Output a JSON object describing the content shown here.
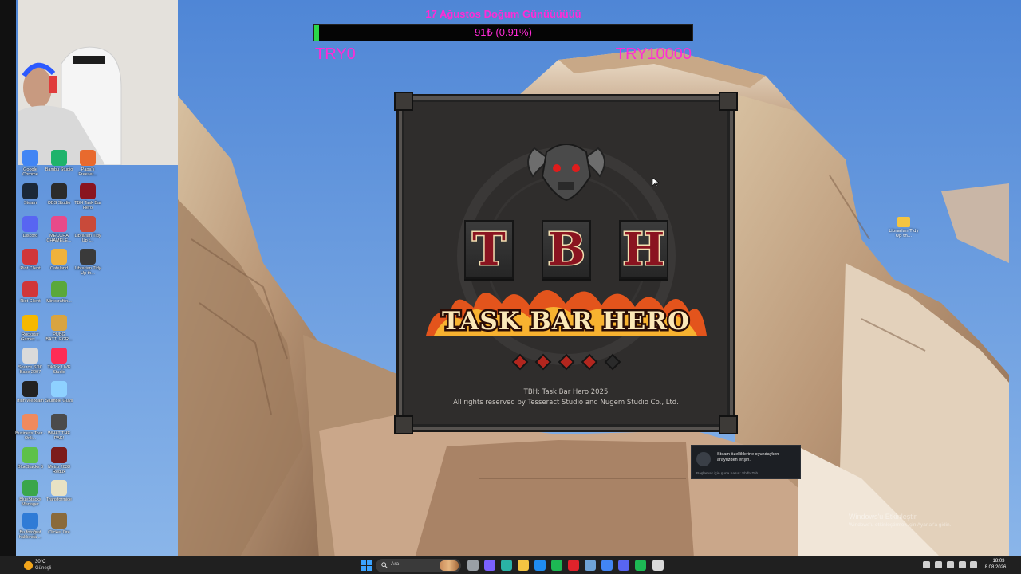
{
  "goal": {
    "title": "17 Ağustos Doğum Günüüüüüü",
    "progress_text": "91₺ (0.91%)",
    "progress_fraction": 0.0091,
    "min_label": "TRY0",
    "max_label": "TRY10000",
    "accent_color": "#ff2bd6",
    "fill_color": "#2bd84a"
  },
  "desktop_icons": [
    {
      "label": "Google Chrome",
      "icon": "chrome-icon"
    },
    {
      "label": "Bambu Studio",
      "icon": "bambu-icon"
    },
    {
      "label": "Papa's Freezer...",
      "icon": "papa-icon"
    },
    {
      "label": "Steam",
      "icon": "steam-icon"
    },
    {
      "label": "OBS Studio",
      "icon": "obs-icon"
    },
    {
      "label": "TBH Task Bar Hero",
      "icon": "tbh-icon"
    },
    {
      "label": "Discord",
      "icon": "discord-icon"
    },
    {
      "label": "MECCHA CHAMELE...",
      "icon": "meccha-icon"
    },
    {
      "label": "Librarian Tidy Up t...",
      "icon": "librarian-icon"
    },
    {
      "label": "Riot Client",
      "icon": "riot-icon"
    },
    {
      "label": "Cafeland",
      "icon": "cafeland-icon"
    },
    {
      "label": "Librarian Tidy Up th...",
      "icon": "librarian2-icon"
    },
    {
      "label": "Riot Client",
      "icon": "riot2-icon"
    },
    {
      "label": "Minecraftin...",
      "icon": "minecraft-icon"
    },
    {
      "label": "Rockstar Games ...",
      "icon": "rockstar-icon"
    },
    {
      "label": "PUBG BATTLEGR...",
      "icon": "pubg-icon"
    },
    {
      "label": "Source SDK Base 2007",
      "icon": "sourcesdk-icon"
    },
    {
      "label": "TikTok LIVE Studio",
      "icon": "tiktok-icon"
    },
    {
      "label": "Iriun Webcam",
      "icon": "iriun-icon"
    },
    {
      "label": "Stumble Guys",
      "icon": "stumble-icon"
    },
    {
      "label": "Business Tour - Onli...",
      "icon": "businesstour-icon"
    },
    {
      "label": "WHAT THE PAK!",
      "icon": "whatthepak-icon"
    },
    {
      "label": "BlueStacks 5",
      "icon": "bluestacks-icon"
    },
    {
      "label": "Metro 2033 Redux",
      "icon": "metro-icon"
    },
    {
      "label": "BlueStacks Manager",
      "icon": "bluestacksmgr-icon"
    },
    {
      "label": "Transformice",
      "icon": "transformice-icon"
    },
    {
      "label": "Bu fotoğraf hakkında ...",
      "icon": "photo-info-icon"
    },
    {
      "label": "Clicker Ore",
      "icon": "clickerore-icon"
    }
  ],
  "right_file_icon": {
    "label": "Librarian Tidy Up th..."
  },
  "game": {
    "letters": [
      "T",
      "B",
      "H"
    ],
    "logo_text": "TASK BAR HERO",
    "credit_title": "TBH: Task Bar Hero  2025",
    "credit_rights": "All rights reserved by Tesseract Studio and Nugem Studio Co., Ltd.",
    "gem_count": 5,
    "gems_lit": 4
  },
  "steam_toast": {
    "message": "Steam özelliklerine oyundayken arayüzden erişin.",
    "hint": "Başlamak için şuna basın: Shift+Tab"
  },
  "activation": {
    "title": "Windows'u Etkinleştir",
    "subtitle": "Windows'u etkinleştirmek için Ayarlar'a gidin."
  },
  "taskbar": {
    "weather_temp": "30°C",
    "weather_desc": "Güneşli",
    "search_placeholder": "Ara",
    "time": "18:03",
    "date": "8.08.2026"
  }
}
